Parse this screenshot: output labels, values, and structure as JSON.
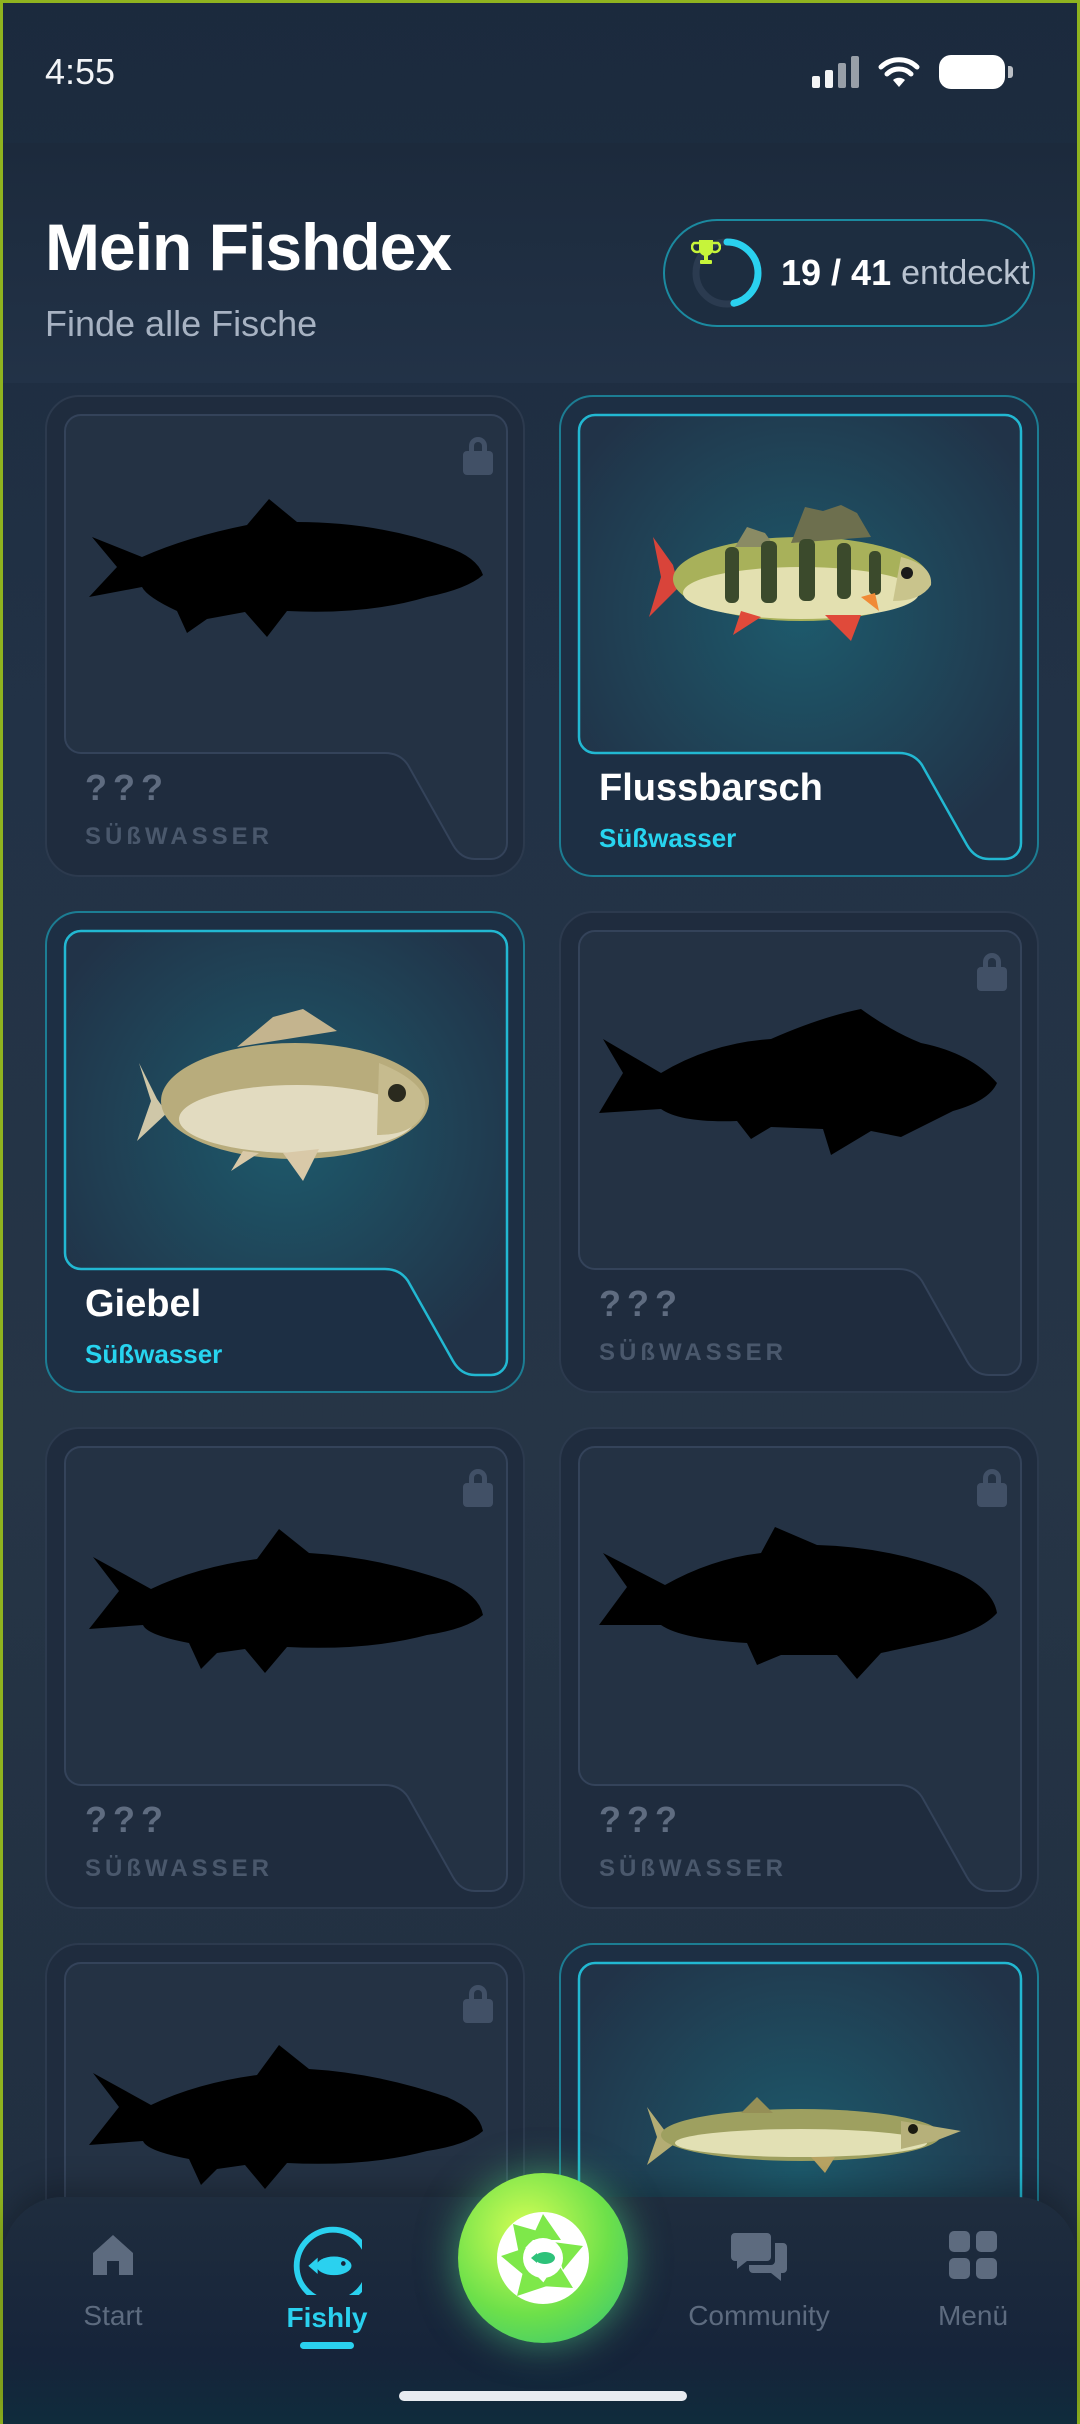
{
  "status": {
    "time": "4:55"
  },
  "header": {
    "title": "Mein Fishdex",
    "subtitle": "Finde alle Fische"
  },
  "progress": {
    "count": "19 / 41",
    "label": "entdeckt",
    "discovered": 19,
    "total": 41
  },
  "cards": [
    {
      "name": "???",
      "type": "SÜßWASSER",
      "discovered": false
    },
    {
      "name": "Flussbarsch",
      "type": "Süßwasser",
      "discovered": true
    },
    {
      "name": "Giebel",
      "type": "Süßwasser",
      "discovered": true
    },
    {
      "name": "???",
      "type": "SÜßWASSER",
      "discovered": false
    },
    {
      "name": "???",
      "type": "SÜßWASSER",
      "discovered": false
    },
    {
      "name": "???",
      "type": "SÜßWASSER",
      "discovered": false
    },
    {
      "name": "",
      "type": "",
      "discovered": false
    },
    {
      "name": "",
      "type": "",
      "discovered": true
    }
  ],
  "nav": {
    "start": "Start",
    "fishly": "Fishly",
    "community": "Community",
    "menu": "Menü"
  },
  "colors": {
    "accent": "#2ad1ef",
    "camera": "#7ee84a",
    "trophy": "#c6f43a"
  }
}
